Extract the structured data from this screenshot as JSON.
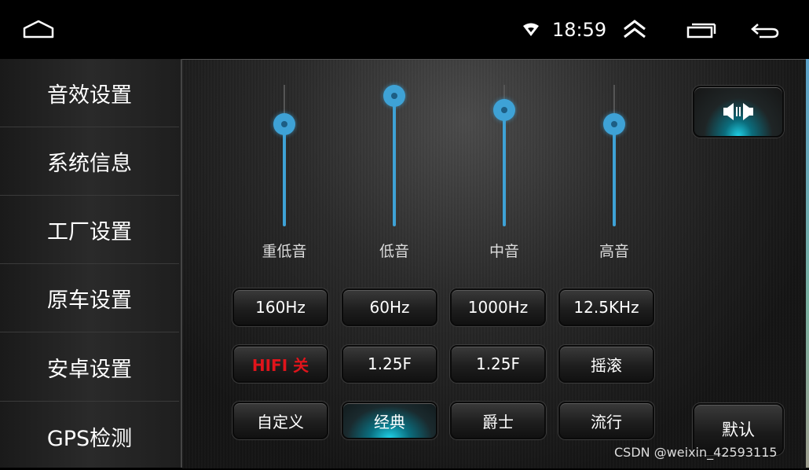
{
  "statusbar": {
    "time": "18:59"
  },
  "sidebar": {
    "items": [
      {
        "label": "音效设置"
      },
      {
        "label": "系统信息"
      },
      {
        "label": "工厂设置"
      },
      {
        "label": "原车设置"
      },
      {
        "label": "安卓设置"
      },
      {
        "label": "GPS检测"
      }
    ]
  },
  "equalizer": {
    "bands": [
      {
        "label": "重低音",
        "level": 0.72
      },
      {
        "label": "低音",
        "level": 0.92
      },
      {
        "label": "中音",
        "level": 0.82
      },
      {
        "label": "高音",
        "level": 0.72
      }
    ]
  },
  "buttons": {
    "freq": [
      "160Hz",
      "60Hz",
      "1000Hz",
      "12.5KHz"
    ],
    "row2": [
      "HIFI 关",
      "1.25F",
      "1.25F",
      "摇滚"
    ],
    "presets": [
      "自定义",
      "经典",
      "爵士",
      "流行"
    ],
    "active_preset": "经典",
    "default_label": "默认"
  },
  "icons": {
    "home": "home-icon",
    "wifi": "wifi-icon",
    "up": "chevron-up-icon",
    "recent": "recent-apps-icon",
    "back": "back-icon",
    "speaker": "speaker-balance-icon"
  },
  "colors": {
    "accent": "#3ea2d6",
    "active_glow": "#1fd0e6",
    "hifi_text": "#e0141b"
  },
  "watermark": "CSDN @weixin_42593115"
}
